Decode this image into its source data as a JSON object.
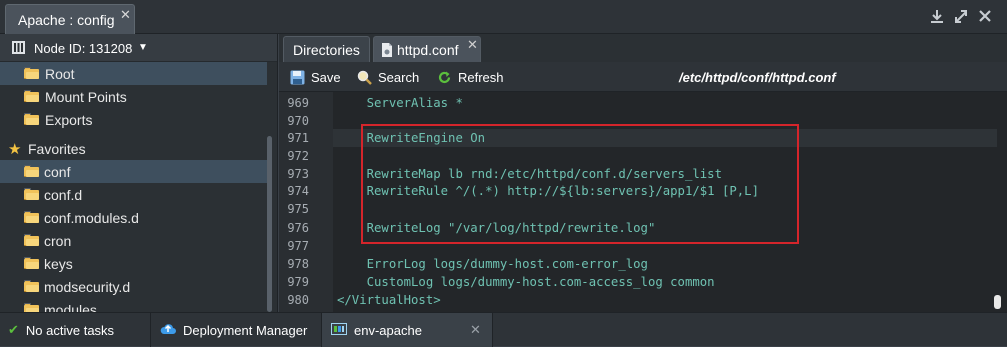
{
  "window": {
    "title": "Apache : config",
    "close_glyph": "✕",
    "icons": [
      "download-icon",
      "expand-icon",
      "close-icon"
    ]
  },
  "left": {
    "node_label": "Node ID: 131208",
    "items": [
      {
        "label": "Root",
        "selected": true
      },
      {
        "label": "Mount Points"
      },
      {
        "label": "Exports"
      },
      {
        "label": "Favorites",
        "icon": "star-icon"
      },
      {
        "label": "conf",
        "selected": true
      },
      {
        "label": "conf.d"
      },
      {
        "label": "conf.modules.d"
      },
      {
        "label": "cron"
      },
      {
        "label": "keys"
      },
      {
        "label": "modsecurity.d"
      },
      {
        "label": "modules"
      }
    ]
  },
  "tabs": [
    {
      "label": "Directories"
    },
    {
      "label": "httpd.conf",
      "active": true
    }
  ],
  "toolbar": {
    "save": "Save",
    "search": "Search",
    "refresh": "Refresh",
    "path": "/etc/httpd/conf/httpd.conf"
  },
  "editor": {
    "lines": [
      {
        "n": "969",
        "t": "    ServerAlias *"
      },
      {
        "n": "970",
        "t": ""
      },
      {
        "n": "971",
        "t": "    RewriteEngine On"
      },
      {
        "n": "972",
        "t": ""
      },
      {
        "n": "973",
        "t": "    RewriteMap lb rnd:/etc/httpd/conf.d/servers_list"
      },
      {
        "n": "974",
        "t": "    RewriteRule ^/(.*) http://${lb:servers}/app1/$1 [P,L]"
      },
      {
        "n": "975",
        "t": ""
      },
      {
        "n": "976",
        "t": "    RewriteLog \"/var/log/httpd/rewrite.log\""
      },
      {
        "n": "977",
        "t": ""
      },
      {
        "n": "978",
        "t": "    ErrorLog logs/dummy-host.com-error_log"
      },
      {
        "n": "979",
        "t": "    CustomLog logs/dummy-host.com-access_log common"
      },
      {
        "n": "980",
        "t": "</VirtualHost>"
      }
    ],
    "highlight_color": "#d4252b"
  },
  "status": {
    "tasks": "No active tasks",
    "deployment": "Deployment Manager",
    "env": "env-apache",
    "close_glyph": "✕"
  }
}
